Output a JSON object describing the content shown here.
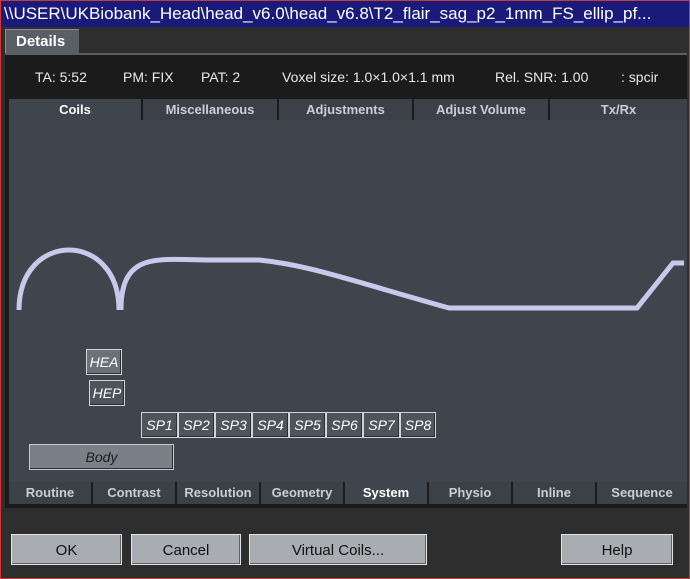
{
  "window": {
    "title": "\\\\USER\\UKBiobank_Head\\head_v6.0\\head_v6.8\\T2_flair_sag_p2_1mm_FS_ellip_pf..."
  },
  "header": {
    "tab_label": "Details"
  },
  "info": {
    "ta": "TA: 5:52",
    "pm": "PM: FIX",
    "pat": "PAT: 2",
    "voxel": "Voxel size: 1.0×1.0×1.1 mm",
    "snr": "Rel. SNR: 1.00",
    "seq": ": spcir"
  },
  "top_tabs": [
    {
      "label": "Coils",
      "active": true
    },
    {
      "label": "Miscellaneous",
      "active": false
    },
    {
      "label": "Adjustments",
      "active": false
    },
    {
      "label": "Adjust Volume",
      "active": false
    },
    {
      "label": "Tx/Rx",
      "active": false
    }
  ],
  "coils": {
    "hea": "HEA",
    "hep": "HEP",
    "spine": [
      "SP1",
      "SP2",
      "SP3",
      "SP4",
      "SP5",
      "SP6",
      "SP7",
      "SP8"
    ],
    "body": "Body"
  },
  "bottom_tabs": [
    {
      "label": "Routine",
      "active": false
    },
    {
      "label": "Contrast",
      "active": false
    },
    {
      "label": "Resolution",
      "active": false
    },
    {
      "label": "Geometry",
      "active": false
    },
    {
      "label": "System",
      "active": true
    },
    {
      "label": "Physio",
      "active": false
    },
    {
      "label": "Inline",
      "active": false
    },
    {
      "label": "Sequence",
      "active": false
    }
  ],
  "footer": {
    "ok": "OK",
    "cancel": "Cancel",
    "virtual_coils": "Virtual Coils...",
    "help": "Help"
  },
  "colors": {
    "title_bar": "#1a1a7a",
    "panel": "#3e454d",
    "coil_outline": "#c8c8ea",
    "button": "#a9acb0"
  }
}
